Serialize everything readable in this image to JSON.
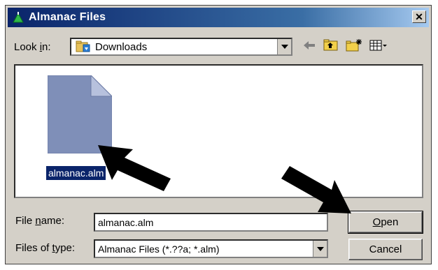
{
  "window": {
    "title": "Almanac Files",
    "close_glyph": "✕"
  },
  "lookin": {
    "label_pre": "Look ",
    "label_accel": "i",
    "label_post": "n:",
    "value": "Downloads"
  },
  "toolbar": {
    "icons": [
      "back-arrow-icon",
      "up-folder-icon",
      "new-folder-icon",
      "view-menu-icon"
    ]
  },
  "files": [
    {
      "name": "almanac.alm",
      "icon": "document-icon",
      "selected": true
    }
  ],
  "filename": {
    "label_pre": "File ",
    "label_accel": "n",
    "label_post": "ame:",
    "value": "almanac.alm"
  },
  "filetype": {
    "label_pre": "Files of ",
    "label_accel": "t",
    "label_post": "ype:",
    "value": "Almanac Files (*.??a; *.alm)"
  },
  "buttons": {
    "open_accel": "O",
    "open_rest": "pen",
    "cancel": "Cancel"
  },
  "colors": {
    "titlebar": "#0a246a",
    "selection": "#0a246a",
    "face": "#d4d0c8",
    "document": "#7f8fb8"
  }
}
